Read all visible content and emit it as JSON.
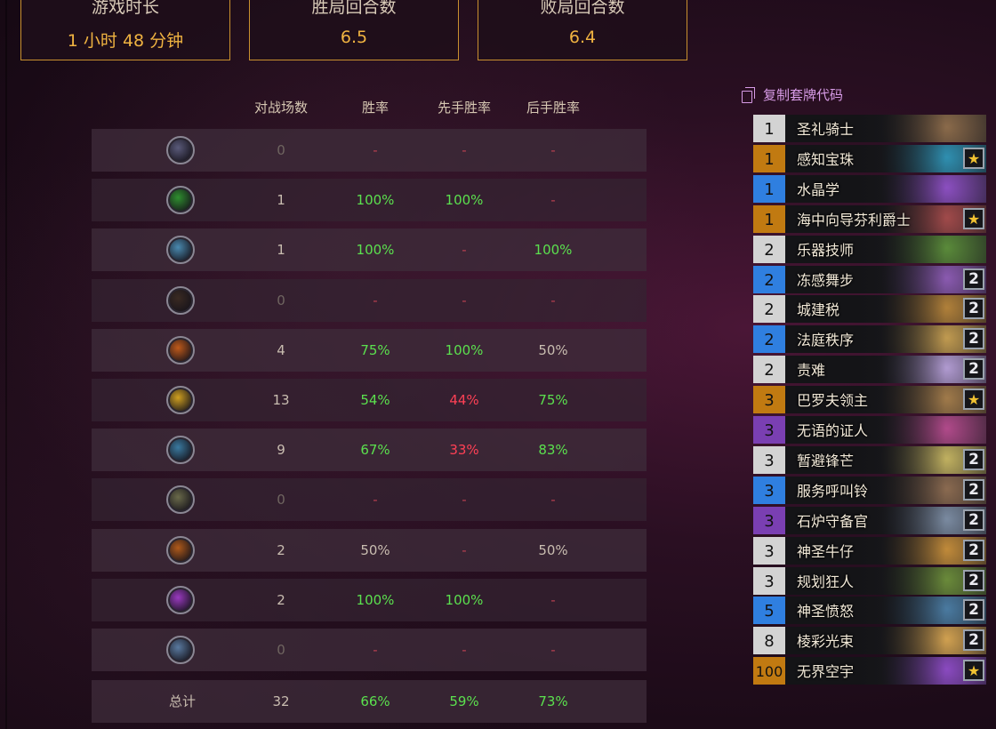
{
  "stats": [
    {
      "label": "游戏时长",
      "value": "1 小时 48 分钟"
    },
    {
      "label": "胜局回合数",
      "value": "6.5"
    },
    {
      "label": "败局回合数",
      "value": "6.4"
    }
  ],
  "table": {
    "headers": {
      "games": "对战场数",
      "winrate": "胜率",
      "first": "先手胜率",
      "second": "后手胜率"
    },
    "rows": [
      {
        "icon": "death-knight-class-icon",
        "games": "0",
        "winrate": "-",
        "first": "-",
        "second": "-"
      },
      {
        "icon": "demon-hunter-class-icon",
        "games": "1",
        "winrate": "100%",
        "first": "100%",
        "second": "-"
      },
      {
        "icon": "druid-class-icon",
        "games": "1",
        "winrate": "100%",
        "first": "-",
        "second": "100%"
      },
      {
        "icon": "hunter-class-icon",
        "games": "0",
        "winrate": "-",
        "first": "-",
        "second": "-"
      },
      {
        "icon": "mage-class-icon",
        "games": "4",
        "winrate": "75%",
        "first": "100%",
        "second": "50%"
      },
      {
        "icon": "paladin-class-icon",
        "games": "13",
        "winrate": "54%",
        "first": "44%",
        "second": "75%"
      },
      {
        "icon": "priest-class-icon",
        "games": "9",
        "winrate": "67%",
        "first": "33%",
        "second": "83%"
      },
      {
        "icon": "rogue-class-icon",
        "games": "0",
        "winrate": "-",
        "first": "-",
        "second": "-"
      },
      {
        "icon": "shaman-class-icon",
        "games": "2",
        "winrate": "50%",
        "first": "-",
        "second": "50%"
      },
      {
        "icon": "warlock-class-icon",
        "games": "2",
        "winrate": "100%",
        "first": "100%",
        "second": "-"
      },
      {
        "icon": "warrior-class-icon",
        "games": "0",
        "winrate": "-",
        "first": "-",
        "second": "-"
      }
    ],
    "total": {
      "label": "总计",
      "games": "32",
      "winrate": "66%",
      "first": "59%",
      "second": "73%"
    }
  },
  "deck": {
    "copy_label": "复制套牌代码",
    "cards": [
      {
        "cost": "1",
        "name": "圣礼骑士",
        "count": "",
        "rarity": "white",
        "art": "#8a6a4a"
      },
      {
        "cost": "1",
        "name": "感知宝珠",
        "count": "★",
        "rarity": "orange",
        "art": "#2f8fb0"
      },
      {
        "cost": "1",
        "name": "水晶学",
        "count": "",
        "rarity": "blue",
        "art": "#8b4fc0"
      },
      {
        "cost": "1",
        "name": "海中向导芬利爵士",
        "count": "★",
        "rarity": "orange",
        "art": "#a04a4a"
      },
      {
        "cost": "2",
        "name": "乐器技师",
        "count": "",
        "rarity": "white",
        "art": "#5a8a3a"
      },
      {
        "cost": "2",
        "name": "冻感舞步",
        "count": "2",
        "rarity": "blue",
        "art": "#8a5ab0"
      },
      {
        "cost": "2",
        "name": "城建税",
        "count": "2",
        "rarity": "white",
        "art": "#b0803a"
      },
      {
        "cost": "2",
        "name": "法庭秩序",
        "count": "2",
        "rarity": "blue",
        "art": "#c09a50"
      },
      {
        "cost": "2",
        "name": "责难",
        "count": "2",
        "rarity": "white",
        "art": "#b09ad0"
      },
      {
        "cost": "3",
        "name": "巴罗夫领主",
        "count": "★",
        "rarity": "orange",
        "art": "#a07a4a"
      },
      {
        "cost": "3",
        "name": "无语的证人",
        "count": "",
        "rarity": "purple",
        "art": "#b04a8a"
      },
      {
        "cost": "3",
        "name": "暂避锋芒",
        "count": "2",
        "rarity": "white",
        "art": "#c0b060"
      },
      {
        "cost": "3",
        "name": "服务呼叫铃",
        "count": "2",
        "rarity": "blue",
        "art": "#8a6a50"
      },
      {
        "cost": "3",
        "name": "石炉守备官",
        "count": "2",
        "rarity": "purple",
        "art": "#7a8aa0"
      },
      {
        "cost": "3",
        "name": "神圣牛仔",
        "count": "2",
        "rarity": "white",
        "art": "#c08a3a"
      },
      {
        "cost": "3",
        "name": "规划狂人",
        "count": "2",
        "rarity": "white",
        "art": "#6a8a3a"
      },
      {
        "cost": "5",
        "name": "神圣愤怒",
        "count": "2",
        "rarity": "blue",
        "art": "#4a7aa0"
      },
      {
        "cost": "8",
        "name": "棱彩光束",
        "count": "2",
        "rarity": "white",
        "art": "#d0a050"
      },
      {
        "cost": "100",
        "name": "无界空宇",
        "count": "★",
        "rarity": "orange",
        "art": "#8a4ac0"
      }
    ]
  },
  "colors": {
    "accent": "#f0b341",
    "positive": "#5be04e",
    "negative": "#ff4055",
    "copy_link": "#d79be6"
  }
}
